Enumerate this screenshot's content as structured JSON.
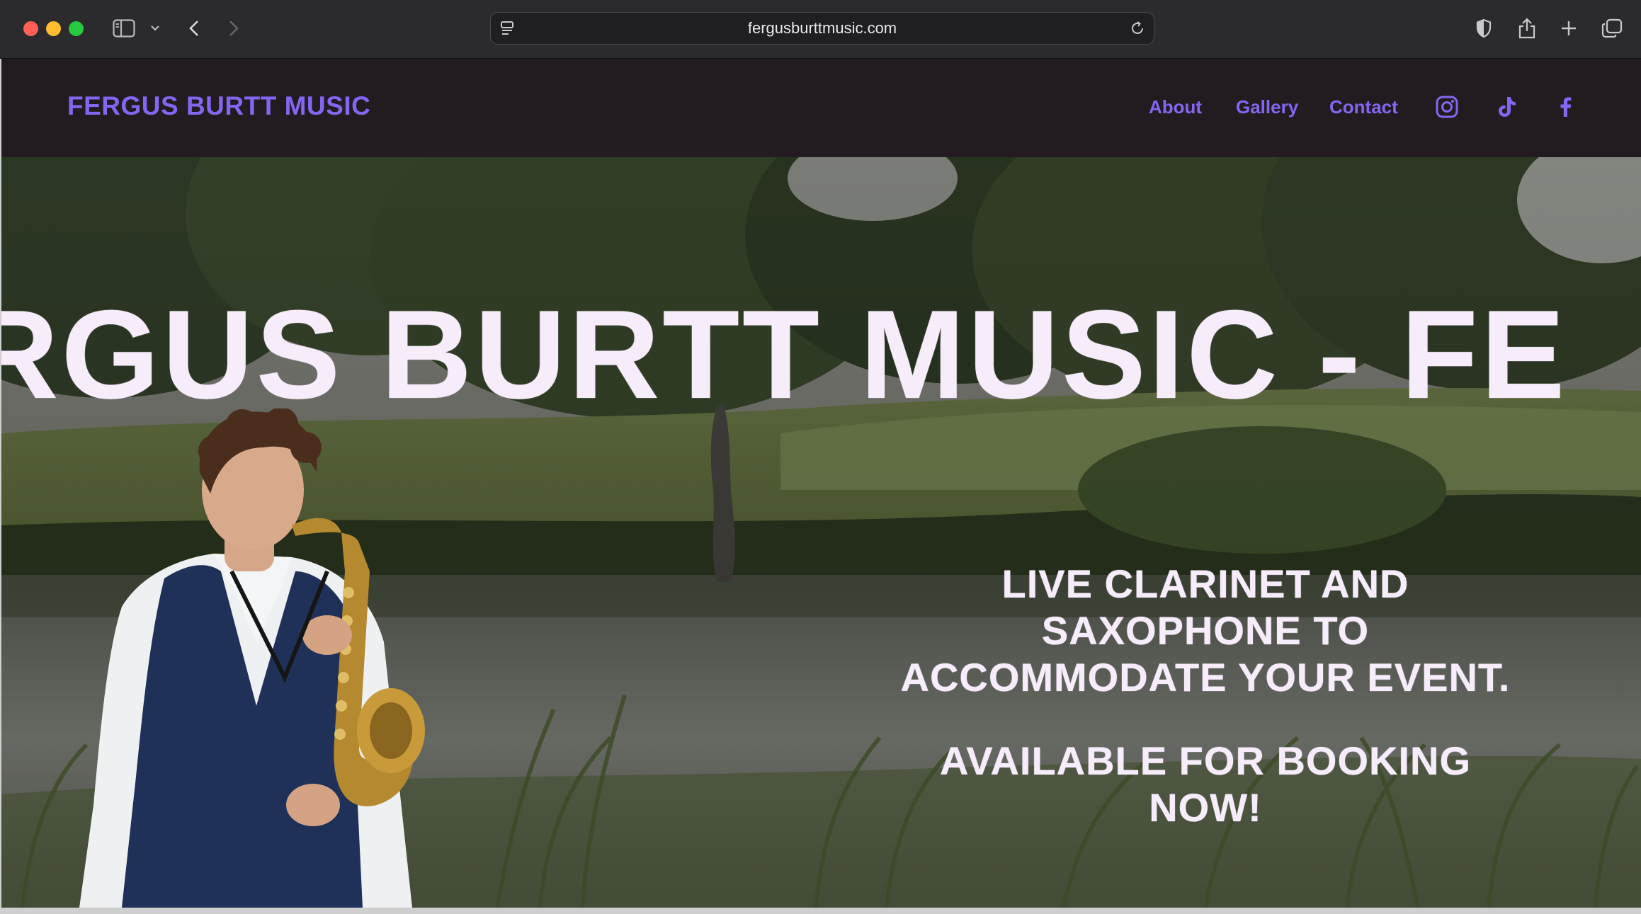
{
  "browser": {
    "url": "fergusburttmusic.com"
  },
  "site": {
    "logo": "FERGUS BURTT MUSIC",
    "nav": [
      {
        "label": "About"
      },
      {
        "label": "Gallery"
      },
      {
        "label": "Contact"
      }
    ],
    "social": [
      "instagram-icon",
      "tiktok-icon",
      "facebook-icon"
    ],
    "accent_color": "#8466f2",
    "header_bg": "#221c20"
  },
  "hero": {
    "marquee": "RGUS BURTT MUSIC - FE",
    "tagline": "LIVE CLARINET AND SAXOPHONE TO ACCOMMODATE YOUR EVENT.",
    "booking": "AVAILABLE FOR BOOKING NOW!",
    "text_color": "#f6ecfa"
  }
}
